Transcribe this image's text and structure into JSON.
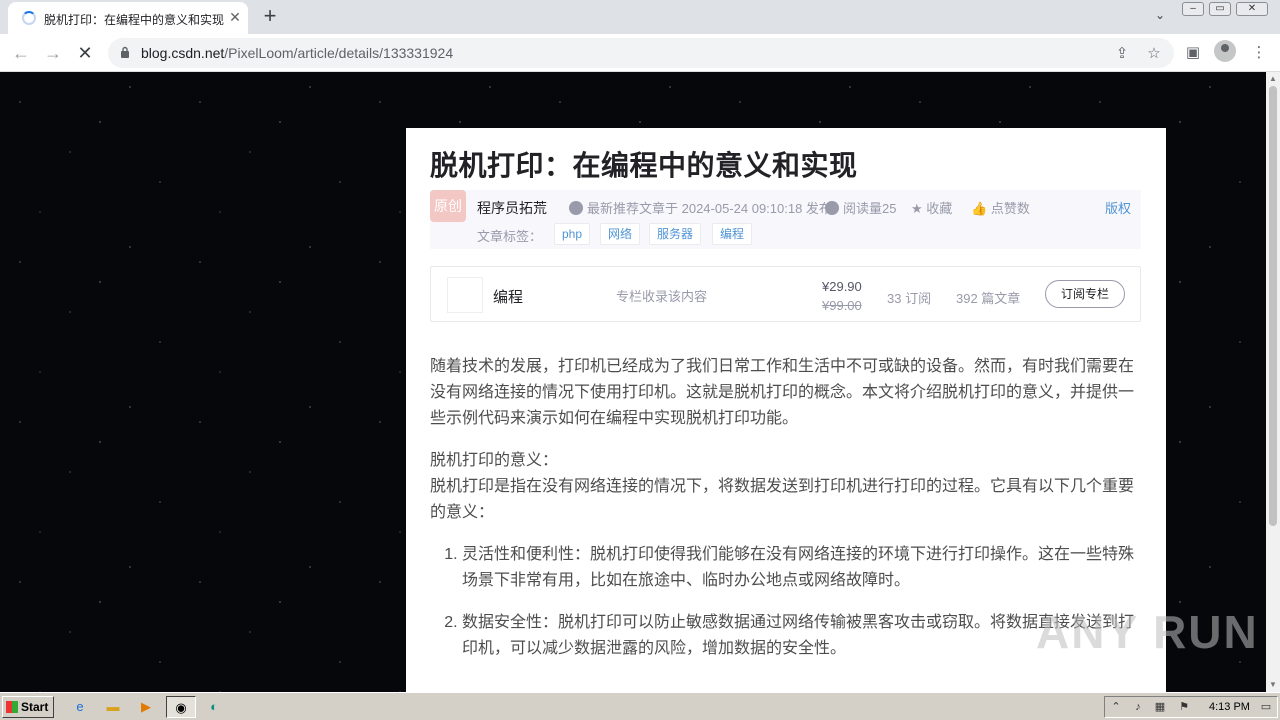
{
  "browser": {
    "tab_title": "脱机打印：在编程中的意义和实现-C",
    "tab_close": "✕",
    "new_tab": "+",
    "url_host": "blog.csdn.net",
    "url_path": "/PixelLoom/article/details/133331924"
  },
  "article": {
    "title": "脱机打印：在编程中的意义和实现",
    "badge": "原创",
    "author": "程序员拓荒",
    "published": "最新推荐文章于 2024-05-24 09:10:18 发布",
    "reads": "阅读量25",
    "favorite": "收藏",
    "like": "点赞数",
    "copyright": "版权",
    "tags_label": "文章标签：",
    "tags": [
      "php",
      "网络",
      "服务器",
      "编程"
    ]
  },
  "column": {
    "name": "编程",
    "desc": "专栏收录该内容",
    "price": "¥29.90",
    "old_price": "¥99.00",
    "subscribers": "33 订阅",
    "articles": "392 篇文章",
    "subscribe": "订阅专栏"
  },
  "content": {
    "p1": "随着技术的发展，打印机已经成为了我们日常工作和生活中不可或缺的设备。然而，有时我们需要在没有网络连接的情况下使用打印机。这就是脱机打印的概念。本文将介绍脱机打印的意义，并提供一些示例代码来演示如何在编程中实现脱机打印功能。",
    "p2_heading": "脱机打印的意义：",
    "p2": "脱机打印是指在没有网络连接的情况下，将数据发送到打印机进行打印的过程。它具有以下几个重要的意义：",
    "li1": "灵活性和便利性：脱机打印使得我们能够在没有网络连接的环境下进行打印操作。这在一些特殊场景下非常有用，比如在旅途中、临时办公地点或网络故障时。",
    "li2": "数据安全性：脱机打印可以防止敏感数据通过网络传输被黑客攻击或窃取。将数据直接发送到打印机，可以减少数据泄露的风险，增加数据的安全性。"
  },
  "watermark": "ANY RUN",
  "taskbar": {
    "start": "Start",
    "clock": "4:13 PM"
  }
}
